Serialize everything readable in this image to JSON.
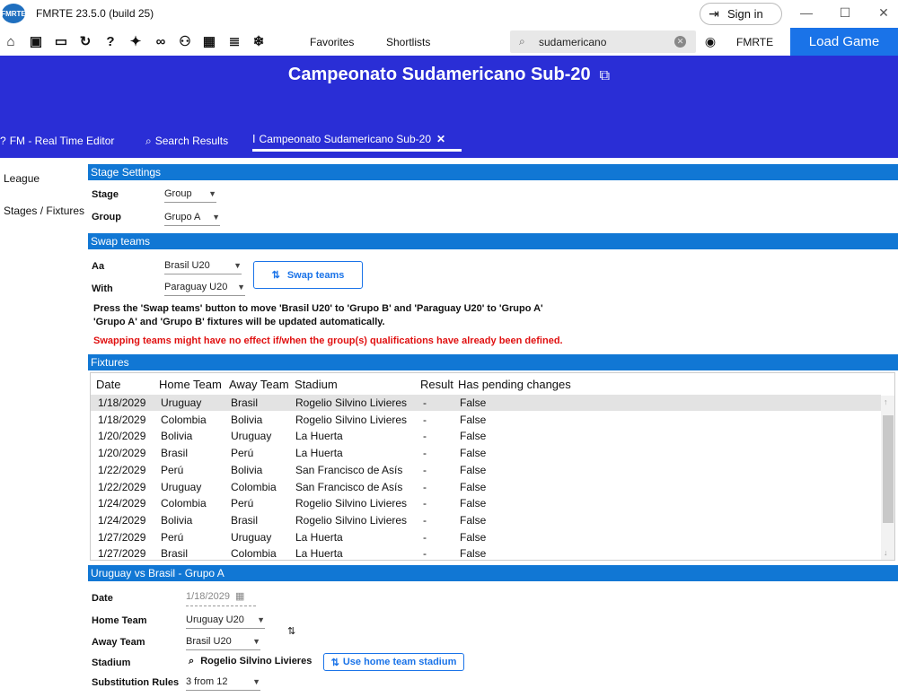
{
  "app": {
    "logo_text": "FMRTE",
    "title": "FMRTE 23.5.0 (build 25)",
    "sign_in": "Sign in"
  },
  "toolbar": {
    "favorites": "Favorites",
    "shortlists": "Shortlists",
    "search_value": "sudamericano",
    "fmrte": "FMRTE",
    "load_game": "Load Game"
  },
  "header": {
    "title": "Campeonato Sudamericano Sub-20",
    "tabs": [
      {
        "label": "FM - Real Time Editor"
      },
      {
        "label": "Search Results"
      },
      {
        "label": "Campeonato Sudamericano Sub-20"
      }
    ]
  },
  "leftnav": {
    "items": [
      "League",
      "Stages / Fixtures"
    ]
  },
  "stage_settings": {
    "section": "Stage Settings",
    "stage_label": "Stage",
    "stage_value": "Group",
    "group_label": "Group",
    "group_value": "Grupo A"
  },
  "swap": {
    "section": "Swap teams",
    "aa_label": "Aa",
    "aa_value": "Brasil U20",
    "with_label": "With",
    "with_value": "Paraguay U20",
    "button": "Swap teams",
    "note1": "Press the 'Swap teams' button to move 'Brasil U20' to 'Grupo B' and 'Paraguay U20' to 'Grupo A'",
    "note2": "'Grupo A' and 'Grupo B' fixtures will be updated automatically.",
    "warning": "Swapping teams might have no effect if/when the group(s) qualifications have already been defined."
  },
  "fixtures": {
    "section": "Fixtures",
    "columns": [
      "Date",
      "Home Team",
      "Away Team",
      "Stadium",
      "Result",
      "Has pending changes"
    ],
    "rows": [
      [
        "1/18/2029",
        "Uruguay",
        "Brasil",
        "Rogelio Silvino Livieres",
        "-",
        "False"
      ],
      [
        "1/18/2029",
        "Colombia",
        "Bolivia",
        "Rogelio Silvino Livieres",
        "-",
        "False"
      ],
      [
        "1/20/2029",
        "Bolivia",
        "Uruguay",
        "La Huerta",
        "-",
        "False"
      ],
      [
        "1/20/2029",
        "Brasil",
        "Perú",
        "La Huerta",
        "-",
        "False"
      ],
      [
        "1/22/2029",
        "Perú",
        "Bolivia",
        "San Francisco de Asís",
        "-",
        "False"
      ],
      [
        "1/22/2029",
        "Uruguay",
        "Colombia",
        "San Francisco de Asís",
        "-",
        "False"
      ],
      [
        "1/24/2029",
        "Colombia",
        "Perú",
        "Rogelio Silvino Livieres",
        "-",
        "False"
      ],
      [
        "1/24/2029",
        "Bolivia",
        "Brasil",
        "Rogelio Silvino Livieres",
        "-",
        "False"
      ],
      [
        "1/27/2029",
        "Perú",
        "Uruguay",
        "La Huerta",
        "-",
        "False"
      ],
      [
        "1/27/2029",
        "Brasil",
        "Colombia",
        "La Huerta",
        "-",
        "False"
      ]
    ]
  },
  "fixture_detail": {
    "section": "Uruguay vs Brasil - Grupo A",
    "date_label": "Date",
    "date_value": "1/18/2029",
    "home_label": "Home Team",
    "home_value": "Uruguay U20",
    "away_label": "Away Team",
    "away_value": "Brasil U20",
    "stadium_label": "Stadium",
    "stadium_value": "Rogelio Silvino Livieres",
    "use_home_stadium": "Use home team stadium",
    "subs_label": "Substitution Rules",
    "subs_value": "3 from 12"
  }
}
